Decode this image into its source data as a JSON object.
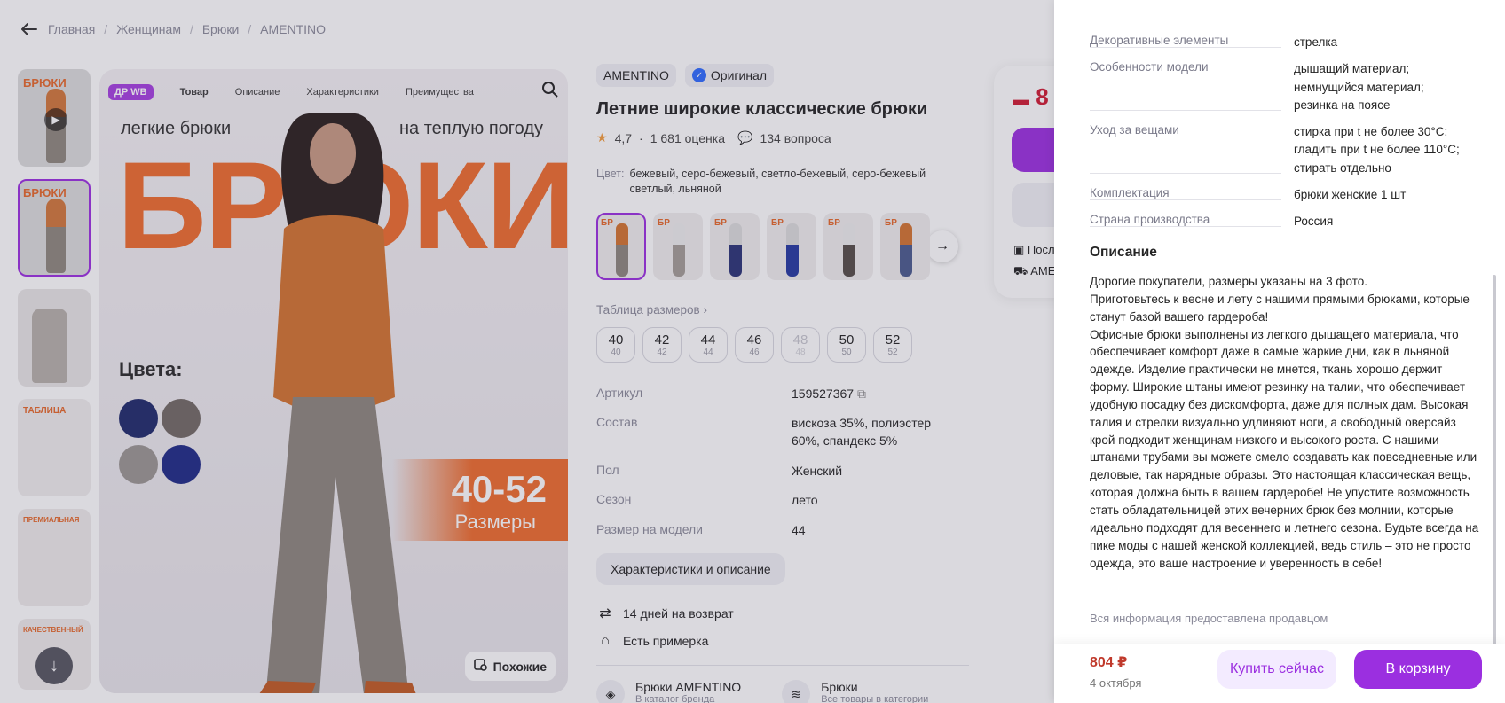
{
  "breadcrumb": [
    "Главная",
    "Женщинам",
    "Брюки",
    "AMENTINO"
  ],
  "main_image": {
    "badge": "ДР WB",
    "tabs": [
      "Товар",
      "Описание",
      "Характеристики",
      "Преимущества"
    ],
    "headline_left": "легкие брюки",
    "headline_right": "на теплую погоду",
    "big_word": "БРЮКИ",
    "colors_label": "Цвета:",
    "sizes_number": "40-52",
    "sizes_label": "Размеры",
    "similar_label": "Похожие"
  },
  "thumbnails": [
    {
      "text": "БРЮКИ",
      "video": true
    },
    {
      "text": "БРЮКИ",
      "video": false
    },
    {
      "text": "",
      "video": false
    },
    {
      "text": "ТАБЛИЦА",
      "video": false
    },
    {
      "text": "ПРЕМИАЛЬНАЯ",
      "video": false
    },
    {
      "text": "КАЧЕСТВЕННЫЙ",
      "video": false
    }
  ],
  "product": {
    "brand": "AMENTINO",
    "original": "Оригинал",
    "title": "Летние широкие классические брюки",
    "rating": "4,7",
    "rating_count": "1 681 оценка",
    "questions": "134 вопроса",
    "color_label": "Цвет:",
    "color_value": "бежевый, серо-бежевый, светло-бежевый, серо-бежевый светлый, льняной",
    "size_table_link": "Таблица размеров",
    "sizes": [
      {
        "ru": "40",
        "eu": "40",
        "available": true
      },
      {
        "ru": "42",
        "eu": "42",
        "available": true
      },
      {
        "ru": "44",
        "eu": "44",
        "available": true
      },
      {
        "ru": "46",
        "eu": "46",
        "available": true
      },
      {
        "ru": "48",
        "eu": "48",
        "available": false
      },
      {
        "ru": "50",
        "eu": "50",
        "available": true
      },
      {
        "ru": "52",
        "eu": "52",
        "available": true
      }
    ],
    "specs": [
      {
        "k": "Артикул",
        "v": "159527367"
      },
      {
        "k": "Состав",
        "v": "вискоза 35%, полиэстер 60%, спандекс 5%"
      },
      {
        "k": "Пол",
        "v": "Женский"
      },
      {
        "k": "Сезон",
        "v": "лето"
      },
      {
        "k": "Размер на модели",
        "v": "44"
      }
    ],
    "details_button": "Характеристики и описание",
    "return_text": "14 дней на возврат",
    "fitting_text": "Есть примерка",
    "brand_link": "Брюки AMENTINO",
    "brand_link_sub": "В каталог бренда",
    "category_link": "Брюки",
    "category_link_sub": "Все товары в категории"
  },
  "buy_card": {
    "price_partial": "8",
    "row1": "Посл",
    "row2": "AME"
  },
  "panel": {
    "properties": [
      {
        "k": "Декоративные элементы",
        "v": "стрелка"
      },
      {
        "k": "Особенности модели",
        "v": "дышащий материал;\nнемнущийся материал;\nрезинка на поясе"
      },
      {
        "k": "Уход за вещами",
        "v": "стирка при t не более 30°C;\nгладить при t не более 110°C;\nстирать отдельно"
      },
      {
        "k": "Комплектация",
        "v": "брюки женские 1 шт"
      },
      {
        "k": "Страна производства",
        "v": "Россия"
      }
    ],
    "description_title": "Описание",
    "description": "Дорогие покупатели, размеры указаны на 3 фото.\nПриготовьтесь к весне и лету с нашими прямыми брюками, которые станут базой вашего гардероба!\nОфисные брюки выполнены из легкого дышащего материала, что обеспечивает комфорт даже в самые жаркие дни, как в льняной одежде. Изделие практически не мнется, ткань хорошо держит форму. Широкие штаны имеют резинку на талии, что обеспечивает удобную посадку без дискомфорта, даже для полных дам. Высокая талия и стрелки визуально удлиняют ноги, а свободный оверсайз крой подходит женщинам низкого и высокого роста. С нашими штанами трубами вы можете смело создавать как повседневные или деловые, так нарядные образы. Это настоящая классическая вещь, которая должна быть в вашем гардеробе! Не упустите возможность стать обладательницей этих вечерних брюк без молнии, которые идеально подходят для весеннего и летнего сезона. Будьте всегда на пике моды с нашей женской коллекцией, ведь стиль – это не просто одежда, это ваше настроение и уверенность в себе!",
    "provided_by": "Вся информация предоставлена продавцом",
    "price": "804 ₽",
    "delivery_date": "4 октября",
    "buy_now": "Купить сейчас",
    "add_to_cart": "В корзину"
  }
}
